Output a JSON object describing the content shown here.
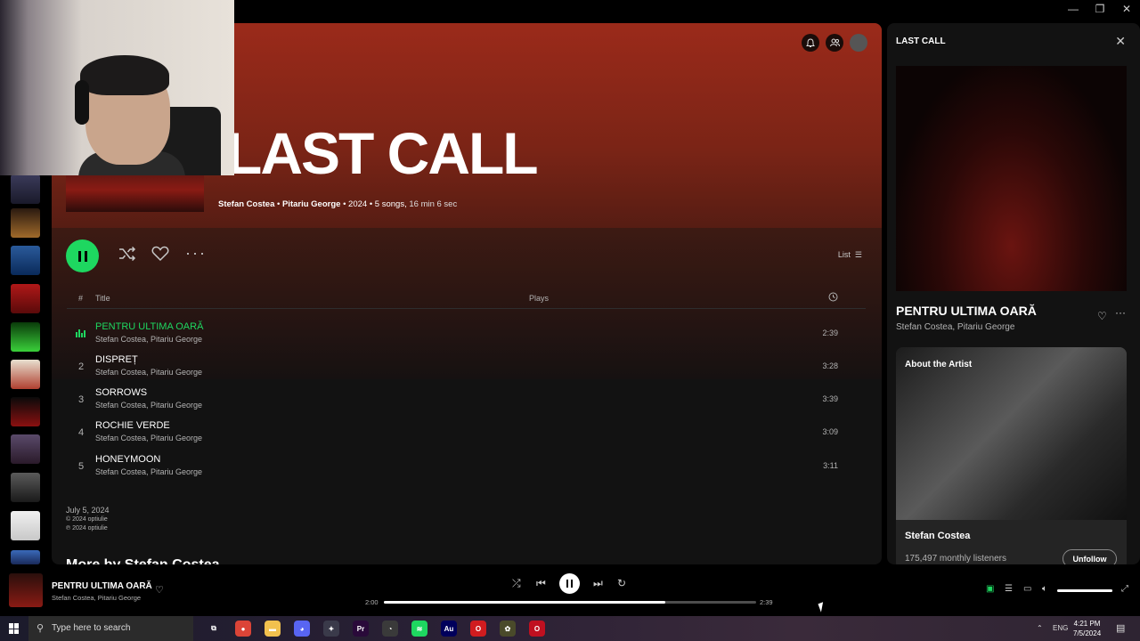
{
  "window": {
    "minimize": "—",
    "restore": "❐",
    "close": "✕"
  },
  "album": {
    "title": "LAST CALL",
    "artist1": "Stefan Costea",
    "artist2": "Pitariu George",
    "year": "2024",
    "songs": "5 songs,",
    "duration": "16 min 6 sec",
    "view_mode": "List"
  },
  "table_header": {
    "num": "#",
    "title": "Title",
    "plays": "Plays"
  },
  "tracks": [
    {
      "num": "1",
      "title": "PENTRU ULTIMA OARĂ",
      "artists": "Stefan Costea, Pitariu George",
      "duration": "2:39",
      "playing": true
    },
    {
      "num": "2",
      "title": "DISPREȚ",
      "artists": "Stefan Costea, Pitariu George",
      "duration": "3:28",
      "playing": false
    },
    {
      "num": "3",
      "title": "SORROWS",
      "artists": "Stefan Costea, Pitariu George",
      "duration": "3:39",
      "playing": false
    },
    {
      "num": "4",
      "title": "ROCHIE VERDE",
      "artists": "Stefan Costea, Pitariu George",
      "duration": "3:09",
      "playing": false
    },
    {
      "num": "5",
      "title": "HONEYMOON",
      "artists": "Stefan Costea, Pitariu George",
      "duration": "3:11",
      "playing": false
    }
  ],
  "release": {
    "date": "July 5, 2024",
    "copyright": "© 2024 optiulie",
    "phonogram": "℗ 2024 optiulie",
    "more_by": "More by Stefan Costea"
  },
  "now_playing_panel": {
    "header": "LAST CALL",
    "track_title": "PENTRU ULTIMA OARĂ",
    "track_artists": "Stefan Costea, Pitariu George",
    "about_label": "About the Artist",
    "artist_name": "Stefan Costea",
    "monthly_listeners": "175,497 monthly listeners",
    "unfollow_label": "Unfollow"
  },
  "player": {
    "title": "PENTRU ULTIMA OARĂ",
    "artists": "Stefan Costea, Pitariu George",
    "elapsed": "2:00",
    "total": "2:39",
    "progress": 0.755,
    "volume": 1.0
  },
  "taskbar": {
    "search_placeholder": "Type here to search",
    "language": "ENG",
    "time": "4:21 PM",
    "date": "7/5/2024",
    "apps": [
      {
        "name": "task-view",
        "label": "⧉",
        "color": "#00000000"
      },
      {
        "name": "chrome",
        "label": "●",
        "color": "#db4437"
      },
      {
        "name": "file-explorer",
        "label": "▬",
        "color": "#f2c14e"
      },
      {
        "name": "discord",
        "label": "◕",
        "color": "#5865f2"
      },
      {
        "name": "app-bird",
        "label": "✦",
        "color": "#3a3a4a"
      },
      {
        "name": "premiere",
        "label": "Pr",
        "color": "#2a0a3a"
      },
      {
        "name": "app-clock",
        "label": "◔",
        "color": "#3a3a3a"
      },
      {
        "name": "spotify",
        "label": "≋",
        "color": "#1ed760"
      },
      {
        "name": "audition",
        "label": "Au",
        "color": "#00005b"
      },
      {
        "name": "opera",
        "label": "O",
        "color": "#d01c1f"
      },
      {
        "name": "fl-studio",
        "label": "✿",
        "color": "#4a4a2a"
      },
      {
        "name": "opera-gx",
        "label": "O",
        "color": "#c01020"
      }
    ]
  },
  "colors": {
    "accent": "#1ed760",
    "hero": "#9b2a1a"
  }
}
